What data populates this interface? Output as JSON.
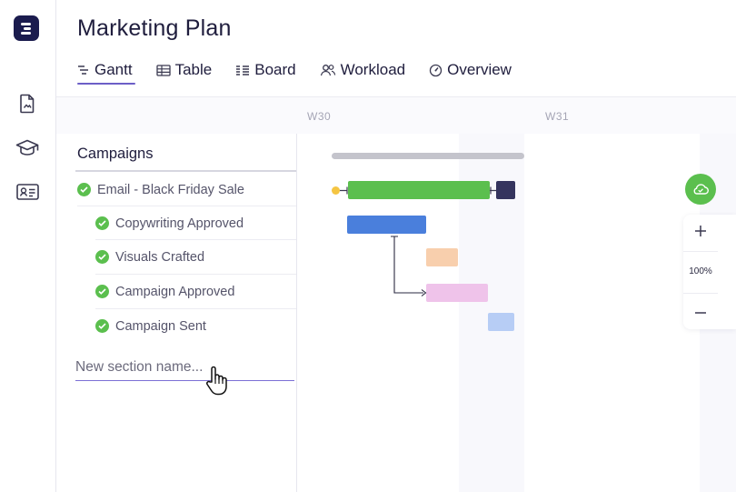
{
  "project": {
    "title": "Marketing Plan"
  },
  "tabs": [
    {
      "label": "Gantt",
      "icon": "gantt-icon",
      "active": true
    },
    {
      "label": "Table",
      "icon": "table-icon",
      "active": false
    },
    {
      "label": "Board",
      "icon": "board-icon",
      "active": false
    },
    {
      "label": "Workload",
      "icon": "workload-icon",
      "active": false
    },
    {
      "label": "Overview",
      "icon": "overview-icon",
      "active": false
    }
  ],
  "sidebar": {
    "icons": [
      "document-icon",
      "graduation-cap-icon",
      "id-card-icon"
    ]
  },
  "timeline": {
    "weeks": [
      "W30",
      "W31"
    ],
    "zoom_level": "100%"
  },
  "section": {
    "name": "Campaigns",
    "tasks": [
      {
        "name": "Email - Black Friday Sale",
        "status": "completed",
        "level": 0,
        "bar_color": "#5bbf4e"
      },
      {
        "name": "Copywriting Approved",
        "status": "completed",
        "level": 1,
        "bar_color": "#4a7fdc"
      },
      {
        "name": "Visuals Crafted",
        "status": "completed",
        "level": 1,
        "bar_color": "#f8cfad"
      },
      {
        "name": "Campaign Approved",
        "status": "completed",
        "level": 1,
        "bar_color": "#efc3ea"
      },
      {
        "name": "Campaign Sent",
        "status": "completed",
        "level": 1,
        "bar_color": "#b7cdf5"
      }
    ]
  },
  "new_section": {
    "placeholder": "New section name..."
  },
  "colors": {
    "accent": "#6c5fc7",
    "success": "#5bbf4e",
    "brand": "#1b1c4e",
    "summary_bar": "#c4c4cc",
    "milestone": "#35345e"
  }
}
